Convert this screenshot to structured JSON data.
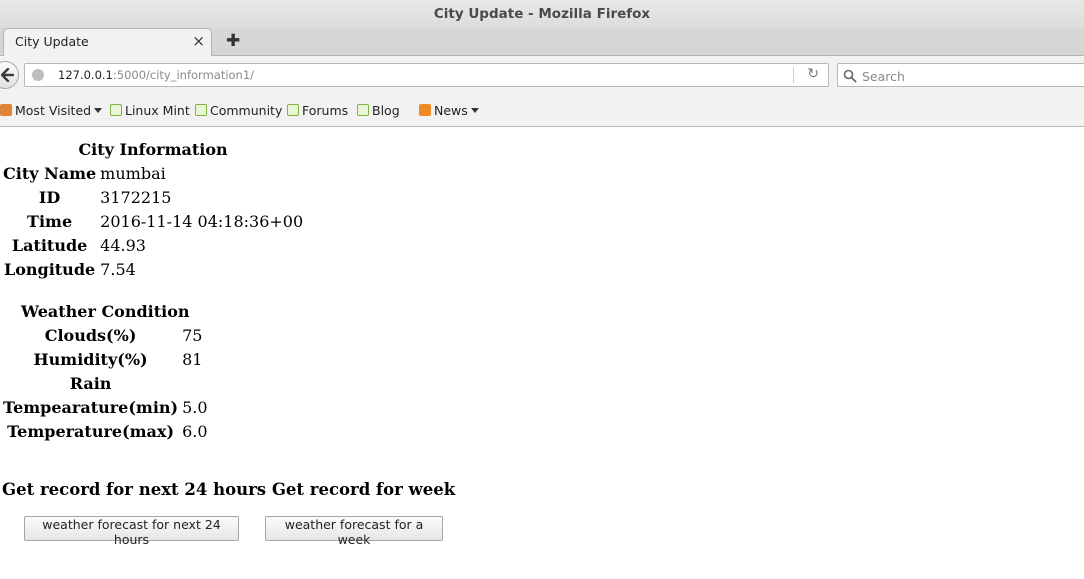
{
  "window": {
    "title": "City Update - Mozilla Firefox"
  },
  "tab": {
    "title": "City Update",
    "close_glyph": "×",
    "new_tab_glyph": "✚"
  },
  "navigation": {
    "url_host": "127.0.0.1",
    "url_path": ":5000/city_information1/",
    "search_placeholder": "Search"
  },
  "bookmarks": [
    {
      "label": "Most Visited",
      "icon": "folder-icon",
      "has_menu": true
    },
    {
      "label": "Linux Mint",
      "icon": "mint-icon"
    },
    {
      "label": "Community",
      "icon": "mint-icon"
    },
    {
      "label": "Forums",
      "icon": "mint-icon"
    },
    {
      "label": "Blog",
      "icon": "mint-icon"
    },
    {
      "label": "News",
      "icon": "rss-icon",
      "has_menu": true
    }
  ],
  "city_info": {
    "caption": "City Information",
    "rows": [
      {
        "label": "City Name",
        "value": "mumbai"
      },
      {
        "label": "ID",
        "value": "3172215"
      },
      {
        "label": "Time",
        "value": "2016-11-14 04:18:36+00"
      },
      {
        "label": "Latitude",
        "value": "44.93"
      },
      {
        "label": "Longitude",
        "value": "7.54"
      }
    ]
  },
  "weather": {
    "caption": "Weather Condition",
    "rows": [
      {
        "label": "Clouds(%)",
        "value": "75"
      },
      {
        "label": "Humidity(%)",
        "value": "81"
      },
      {
        "label": "Rain",
        "value": ""
      },
      {
        "label": "Tempearature(min)",
        "value": "5.0"
      },
      {
        "label": "Temperature(max)",
        "value": "6.0"
      }
    ]
  },
  "records": {
    "heading": "Get record for next 24 hours Get record for week",
    "button_24h": "weather forecast for next 24 hours",
    "button_week": "weather forecast for a week"
  }
}
